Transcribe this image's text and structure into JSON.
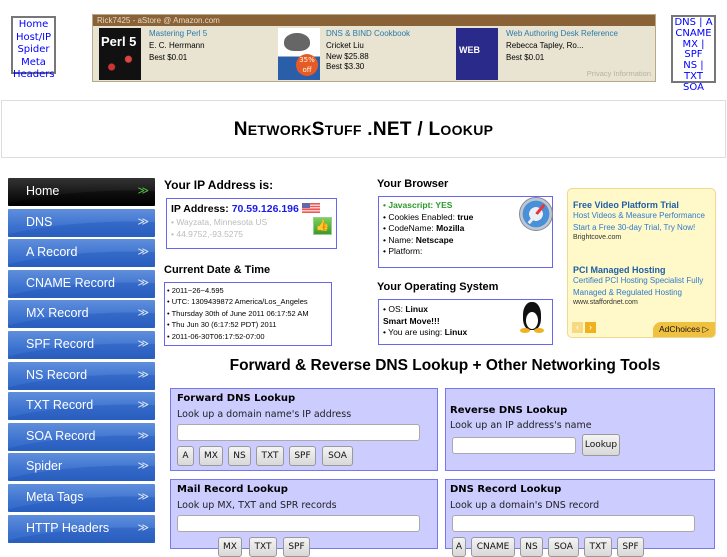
{
  "quick_links_left": [
    "Home",
    "Host/IP",
    "Spider",
    "Meta",
    "Headers"
  ],
  "quick_links_right": [
    "DNS | A",
    "CNAME",
    "MX |",
    "SPF",
    "NS | TXT",
    "SOA"
  ],
  "astore": {
    "header": "Rick7425 - aStore @ Amazon.com",
    "books": [
      {
        "title": "Mastering Perl 5",
        "author": "E. C. Herrmann",
        "price1": "Best $0.01",
        "price2": "",
        "cover_text": "Perl 5"
      },
      {
        "title": "DNS & BIND Cookbook",
        "author": "Cricket Liu",
        "price1": "New $25.88",
        "price2": "Best $3.30",
        "cover_text": "35% off"
      },
      {
        "title": "Web Authoring Desk Reference",
        "author": "Rebecca Tapley, Ro...",
        "price1": "Best $0.01",
        "price2": "",
        "cover_text": "WEB"
      }
    ],
    "privacy": "Privacy Information"
  },
  "banner": {
    "part1_cap": "N",
    "part1": "ETWORK",
    "part2_cap": "S",
    "part2": "TUFF",
    "mid": " .NET / ",
    "part3_cap": "L",
    "part3": "OOKUP"
  },
  "nav": [
    {
      "label": "Home",
      "active": true
    },
    {
      "label": "DNS"
    },
    {
      "label": "A Record"
    },
    {
      "label": "CNAME Record"
    },
    {
      "label": "MX Record"
    },
    {
      "label": "SPF Record"
    },
    {
      "label": "NS Record"
    },
    {
      "label": "TXT Record"
    },
    {
      "label": "SOA Record"
    },
    {
      "label": "Spider"
    },
    {
      "label": "Meta Tags"
    },
    {
      "label": "HTTP Headers"
    }
  ],
  "nav_chevron": "≫",
  "ip": {
    "heading": "Your IP Address is:",
    "label": "IP Address: ",
    "value": "70.59.126.196",
    "location": "• Wayzata, Minnesota US",
    "coords": "• 44.9752,-93.5275"
  },
  "datetime": {
    "heading": "Current Date & Time",
    "lines": [
      "• 2011~26~4.595",
      "• UTC: 1309439872 America/Los_Angeles",
      "• Thursday 30th of June 2011 06:17:52 AM",
      "• Thu Jun 30 (6:17:52 PDT) 2011",
      "• 2011-06-30T06:17:52-07:00"
    ]
  },
  "browser": {
    "heading": "Your Browser",
    "js": "• Javascript: YES",
    "cookies_label": "• Cookies Enabled: ",
    "cookies_value": "true",
    "codename_label": "• CodeName: ",
    "codename_value": "Mozilla",
    "name_label": "• Name: ",
    "name_value": "Netscape",
    "platform_label": "• Platform:"
  },
  "os": {
    "heading": "Your Operating System",
    "os_label": "• OS: ",
    "os_value": "Linux",
    "smart": "Smart Move!!!",
    "using_label": "• You are using: ",
    "using_value": "Linux"
  },
  "ads": [
    {
      "title": "Free Video Platform Trial",
      "text1": "Host Videos & Measure Performance",
      "text2": "Start a Free 30-day Trial, Try Now!",
      "url": "Brightcove.com"
    },
    {
      "title": "PCI Managed Hosting",
      "text1": "Certified PCI Hosting Specialist Fully",
      "text2": "Managed & Regulated Hosting",
      "url": "www.staffordnet.com"
    }
  ],
  "adchoices": "AdChoices",
  "tools_title": "Forward & Reverse DNS Lookup + Other Networking Tools",
  "tools": {
    "forward": {
      "title": "Forward DNS Lookup",
      "desc": "Look up a domain name's IP address",
      "value": "",
      "buttons": [
        "A",
        "MX",
        "NS",
        "TXT",
        "SPF",
        "SOA"
      ]
    },
    "reverse": {
      "title": "Reverse DNS Lookup",
      "desc": "Look up an IP address's name",
      "value": "",
      "button": "Lookup"
    },
    "mail": {
      "title": "Mail Record Lookup",
      "desc": "Look up MX, TXT and SPR records",
      "value": "",
      "buttons": [
        "MX",
        "TXT",
        "SPF"
      ]
    },
    "dnsrec": {
      "title": "DNS Record Lookup",
      "desc": "Look up a domain's DNS record",
      "value": "",
      "buttons": [
        "A",
        "CNAME",
        "NS",
        "SOA",
        "TXT",
        "SPF"
      ]
    }
  }
}
